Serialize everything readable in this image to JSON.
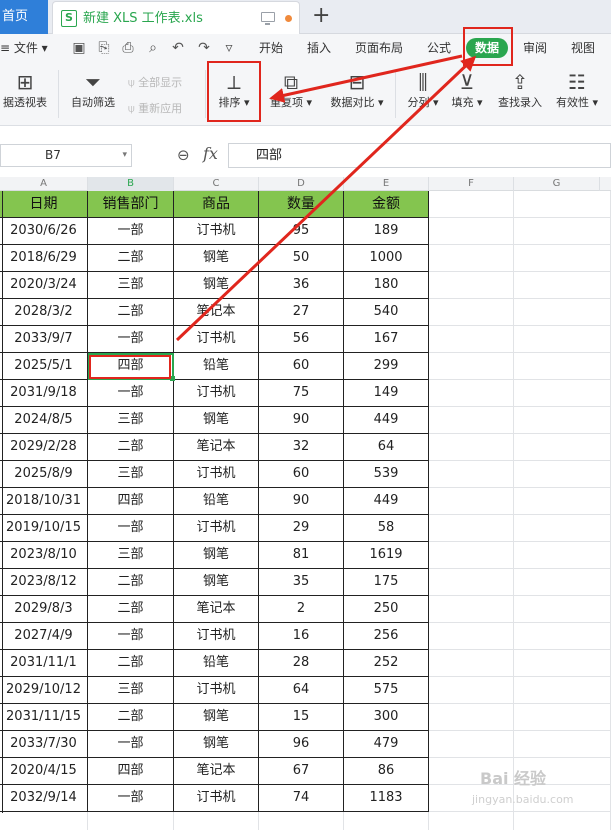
{
  "tabs": {
    "home_label": "首页",
    "file_icon": "S",
    "file_title": "新建 XLS 工作表.xls",
    "new_tab": "+"
  },
  "menu": {
    "file_label": "≡ 文件 ▾",
    "tabs": [
      "开始",
      "插入",
      "页面布局",
      "公式",
      "数据",
      "审阅",
      "视图"
    ],
    "active_tab": "数据"
  },
  "ribbon": {
    "pivot": "据透视表",
    "autofilter": "自动筛选",
    "show_all": "全部显示",
    "reapply": "重新应用",
    "sort": "排序",
    "duplicates": "重复项",
    "compare": "数据对比",
    "split": "分列",
    "fill": "填充",
    "lookup": "查找录入",
    "validation": "有效性"
  },
  "formula_bar": {
    "cell_ref": "B7",
    "fx": "fx",
    "value": "四部"
  },
  "columns": [
    "A",
    "B",
    "C",
    "D",
    "E",
    "F",
    "G"
  ],
  "headers": [
    "日期",
    "销售部门",
    "商品",
    "数量",
    "金额"
  ],
  "rows": [
    [
      "2030/6/26",
      "一部",
      "订书机",
      "95",
      "189"
    ],
    [
      "2018/6/29",
      "二部",
      "钢笔",
      "50",
      "1000"
    ],
    [
      "2020/3/24",
      "三部",
      "钢笔",
      "36",
      "180"
    ],
    [
      "2028/3/2",
      "二部",
      "笔记本",
      "27",
      "540"
    ],
    [
      "2033/9/7",
      "一部",
      "订书机",
      "56",
      "167"
    ],
    [
      "2025/5/1",
      "四部",
      "铅笔",
      "60",
      "299"
    ],
    [
      "2031/9/18",
      "一部",
      "订书机",
      "75",
      "149"
    ],
    [
      "2024/8/5",
      "三部",
      "钢笔",
      "90",
      "449"
    ],
    [
      "2029/2/28",
      "二部",
      "笔记本",
      "32",
      "64"
    ],
    [
      "2025/8/9",
      "三部",
      "订书机",
      "60",
      "539"
    ],
    [
      "2018/10/31",
      "四部",
      "铅笔",
      "90",
      "449"
    ],
    [
      "2019/10/15",
      "一部",
      "订书机",
      "29",
      "58"
    ],
    [
      "2023/8/10",
      "三部",
      "钢笔",
      "81",
      "1619"
    ],
    [
      "2023/8/12",
      "二部",
      "钢笔",
      "35",
      "175"
    ],
    [
      "2029/8/3",
      "二部",
      "笔记本",
      "2",
      "250"
    ],
    [
      "2027/4/9",
      "一部",
      "订书机",
      "16",
      "256"
    ],
    [
      "2031/11/1",
      "二部",
      "铅笔",
      "28",
      "252"
    ],
    [
      "2029/10/12",
      "三部",
      "订书机",
      "64",
      "575"
    ],
    [
      "2031/11/15",
      "二部",
      "钢笔",
      "15",
      "300"
    ],
    [
      "2033/7/30",
      "一部",
      "钢笔",
      "96",
      "479"
    ],
    [
      "2020/4/15",
      "四部",
      "笔记本",
      "67",
      "86"
    ],
    [
      "2032/9/14",
      "一部",
      "订书机",
      "74",
      "1183"
    ]
  ],
  "colors": {
    "accent": "#2aa64f",
    "header_fill": "#84c54f",
    "annotation": "#e0261d"
  },
  "watermark": {
    "brand": "Bai 经验",
    "site": "jingyan.baidu.com"
  }
}
